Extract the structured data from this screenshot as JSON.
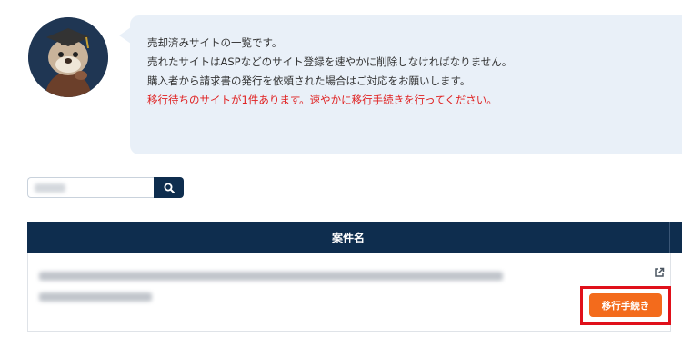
{
  "message": {
    "line1": "売却済みサイトの一覧です。",
    "line2": "売れたサイトはASPなどのサイト登録を速やかに削除しなければなりません。",
    "line3": "購入者から請求書の発行を依頼された場合はご対応をお願いします。",
    "warning": "移行待ちのサイトが1件あります。速やかに移行手続きを行ってください。"
  },
  "search": {
    "icon": "search-icon"
  },
  "table": {
    "column_title": "案件名",
    "rows": [
      {
        "action_label": "移行手続き",
        "external_icon": "external-link-icon"
      }
    ]
  },
  "colors": {
    "navy": "#0e2d4e",
    "bubble_bg": "#e9f0f8",
    "warning_text": "#e02020",
    "action_button": "#f36b1c",
    "highlight_border": "#e0101a"
  }
}
